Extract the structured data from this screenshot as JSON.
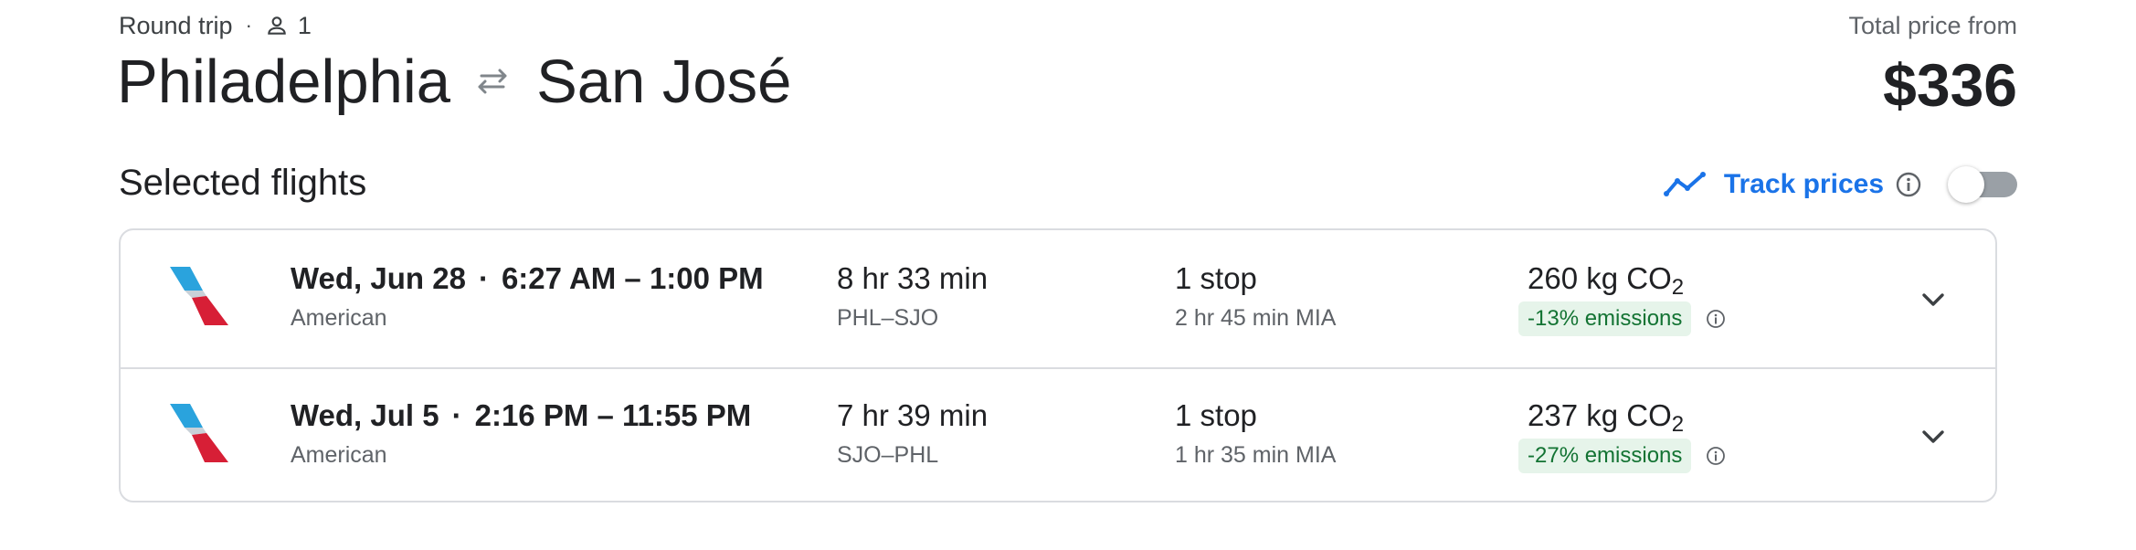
{
  "header": {
    "trip_type": "Round trip",
    "separator": "·",
    "passengers": "1",
    "origin": "Philadelphia",
    "destination": "San José",
    "price_label": "Total price from",
    "price": "$336"
  },
  "section": {
    "title": "Selected flights",
    "track_label": "Track prices",
    "track_enabled": false
  },
  "flights": [
    {
      "date": "Wed, Jun 28",
      "times": "6:27 AM – 1:00 PM",
      "airline": "American",
      "duration": "8 hr 33 min",
      "route": "PHL–SJO",
      "stops": "1 stop",
      "layover": "2 hr 45 min MIA",
      "emissions_value": "260 kg CO",
      "emissions_sub": "2",
      "emissions_badge": "-13% emissions"
    },
    {
      "date": "Wed, Jul 5",
      "times": "2:16 PM – 11:55 PM",
      "airline": "American",
      "duration": "7 hr 39 min",
      "route": "SJO–PHL",
      "stops": "1 stop",
      "layover": "1 hr 35 min MIA",
      "emissions_value": "237 kg CO",
      "emissions_sub": "2",
      "emissions_badge": "-27% emissions"
    }
  ],
  "colors": {
    "accent": "#1a73e8",
    "text": "#202124",
    "muted": "#5f6368",
    "border": "#dadce0",
    "badge_bg": "#e6f4ea",
    "badge_text": "#137333"
  },
  "icons": {
    "passenger": "person-icon",
    "swap": "swap-arrows-icon",
    "track": "trend-line-icon",
    "info": "info-icon",
    "expand": "chevron-down-icon",
    "airline_logo": "american-airlines-logo"
  }
}
